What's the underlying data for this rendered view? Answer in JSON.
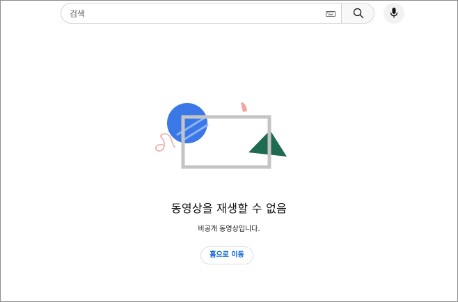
{
  "search": {
    "placeholder": "검색"
  },
  "error": {
    "title": "동영상을 재생할 수 없음",
    "subtitle": "비공개 동영상입니다.",
    "home_button_label": "홈으로 이동"
  },
  "icons": {
    "keyboard": "keyboard-icon",
    "search": "search-icon",
    "mic": "microphone-icon"
  },
  "colors": {
    "accent_link": "#065fd4",
    "illustration_blue": "#3b78e7",
    "illustration_green": "#1e6b52",
    "illustration_pink": "#f0a6a6",
    "frame_gray": "#c4c4c4"
  }
}
